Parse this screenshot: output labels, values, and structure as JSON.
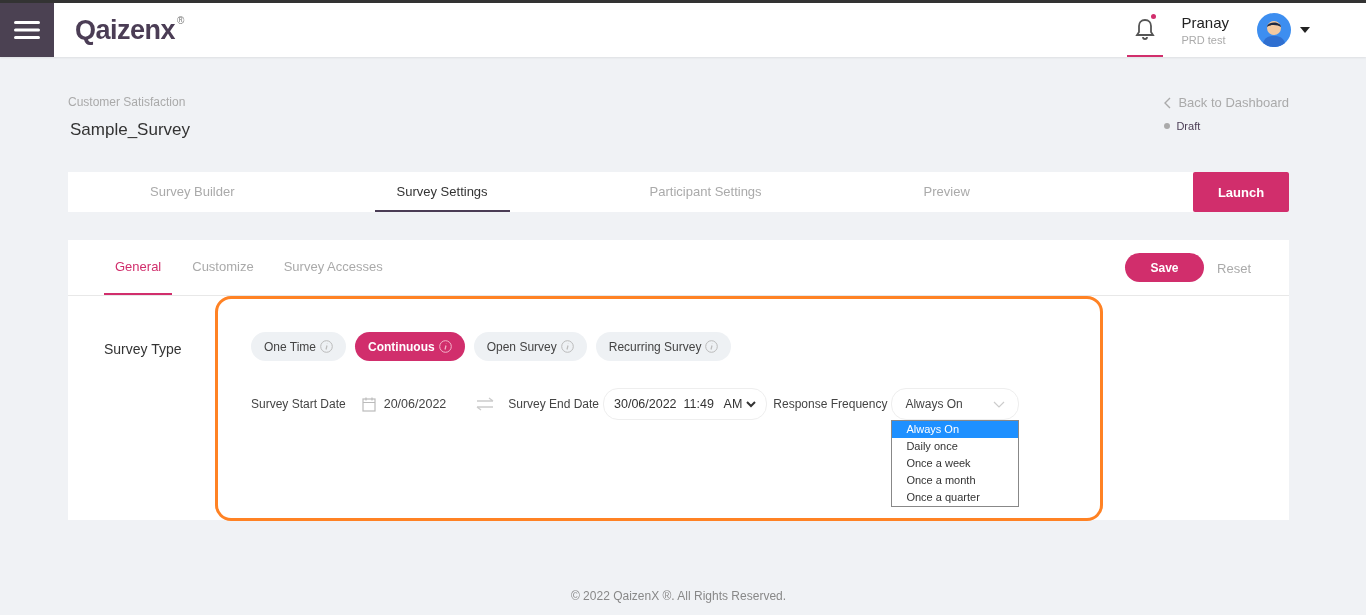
{
  "header": {
    "logo": "Qaizenx",
    "registered": "®",
    "notification_unread": true,
    "user": {
      "name": "Pranay",
      "role": "PRD test"
    }
  },
  "page": {
    "breadcrumb": "Customer Satisfaction",
    "title": "Sample_Survey",
    "back_link": "Back to Dashboard",
    "status": "Draft"
  },
  "tabs": [
    {
      "label": "Survey Builder",
      "selected": false
    },
    {
      "label": "Survey Settings",
      "selected": true
    },
    {
      "label": "Participant Settings",
      "selected": false
    },
    {
      "label": "Preview",
      "selected": false
    }
  ],
  "launch_button": "Launch",
  "sub_tabs": [
    {
      "label": "General",
      "selected": true
    },
    {
      "label": "Customize",
      "selected": false
    },
    {
      "label": "Survey Accesses",
      "selected": false
    }
  ],
  "save_button": "Save",
  "reset_button": "Reset",
  "survey_type": {
    "label": "Survey Type",
    "options": [
      {
        "label": "One Time",
        "selected": false
      },
      {
        "label": "Continuous",
        "selected": true
      },
      {
        "label": "Open Survey",
        "selected": false
      },
      {
        "label": "Recurring Survey",
        "selected": false
      }
    ]
  },
  "start_date": {
    "label": "Survey Start Date",
    "value": "20/06/2022"
  },
  "end_date": {
    "label": "Survey End Date",
    "value": "30/06/2022  11:49   AM"
  },
  "response_frequency": {
    "label": "Response Frequency",
    "value": "Always On",
    "expanded": true,
    "options": [
      {
        "label": "Always On",
        "selected": true
      },
      {
        "label": "Daily once",
        "selected": false
      },
      {
        "label": "Once a week",
        "selected": false
      },
      {
        "label": "Once a month",
        "selected": false
      },
      {
        "label": "Once a quarter",
        "selected": false
      }
    ]
  },
  "footer": "© 2022 QaizenX ®. All Rights Reserved."
}
